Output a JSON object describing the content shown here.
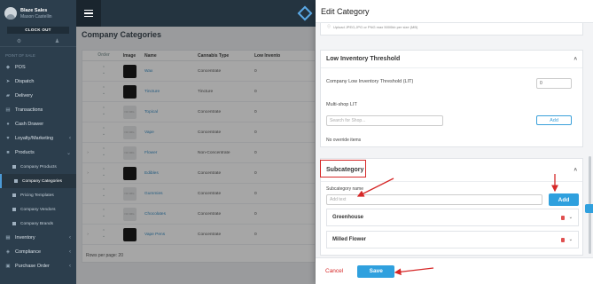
{
  "sidebar": {
    "user_name": "Blaze Sales",
    "user_sub": "Mason Castellin",
    "clock_out": "CLOCK OUT",
    "section": "POINT OF SALE",
    "items": [
      {
        "label": "POS",
        "icon": "tag-icon"
      },
      {
        "label": "Dispatch",
        "icon": "dispatch-icon"
      },
      {
        "label": "Delivery",
        "icon": "truck-icon"
      },
      {
        "label": "Transactions",
        "icon": "receipt-icon"
      },
      {
        "label": "Cash Drawer",
        "icon": "cash-icon"
      },
      {
        "label": "Loyalty/Marketing",
        "icon": "heart-icon"
      },
      {
        "label": "Products",
        "icon": "box-icon"
      }
    ],
    "sub_items": [
      {
        "label": "Company Products"
      },
      {
        "label": "Company Categories"
      },
      {
        "label": "Pricing Templates"
      },
      {
        "label": "Company Vendors"
      },
      {
        "label": "Company Brands"
      }
    ],
    "bottom_items": [
      {
        "label": "Inventory"
      },
      {
        "label": "Compliance"
      },
      {
        "label": "Purchase Order"
      }
    ]
  },
  "main": {
    "title": "Company Categories",
    "columns": [
      "Order",
      "Image",
      "Name",
      "Cannabis Type",
      "Low Invento"
    ],
    "rows": [
      {
        "name": "Wax",
        "type": "Concentrate",
        "inv": "0",
        "img": "dark"
      },
      {
        "name": "Tincture",
        "type": "Tincture",
        "inv": "0",
        "img": "dark"
      },
      {
        "name": "Topical",
        "type": "Concentrate",
        "inv": "0",
        "img": "noimg"
      },
      {
        "name": "Vape",
        "type": "Concentrate",
        "inv": "0",
        "img": "noimg"
      },
      {
        "name": "Flower",
        "type": "Non-Concentrate",
        "inv": "0",
        "img": "noimg"
      },
      {
        "name": "Edibles",
        "type": "Concentrate",
        "inv": "0",
        "img": "dark"
      },
      {
        "name": "Gummies",
        "type": "Concentrate",
        "inv": "0",
        "img": "noimg"
      },
      {
        "name": "Chocolates",
        "type": "Concentrate",
        "inv": "0",
        "img": "noimg"
      },
      {
        "name": "Vape Pens",
        "type": "Concentrate",
        "inv": "0",
        "img": "dark"
      }
    ],
    "rows_per_page_label": "Rows per page:",
    "rows_per_page_value": "20"
  },
  "modal": {
    "title": "Edit Category",
    "upload_note": "Upload JPEG,JPG or PNG max 5000kb per size (MB)",
    "lit_section": "Low Inventory Threshold",
    "lit_label": "Company Low Inventory Threshold (LIT)",
    "lit_value": "0",
    "multishop_label": "Multi-shop LIT",
    "search_placeholder": "Search for Shop...",
    "add_label": "Add",
    "no_override": "No override items",
    "subcategory_section": "Subcategory",
    "subcategory_name_label": "Subcategory name",
    "subcategory_placeholder": "Add text",
    "subcategory_add": "Add",
    "subcategories": [
      "Greenhouse",
      "Milled Flower"
    ],
    "cancel_label": "Cancel",
    "save_label": "Save"
  },
  "colors": {
    "accent": "#2fa0de",
    "annotation": "#d62828",
    "sidebar": "#2c3e4d"
  }
}
